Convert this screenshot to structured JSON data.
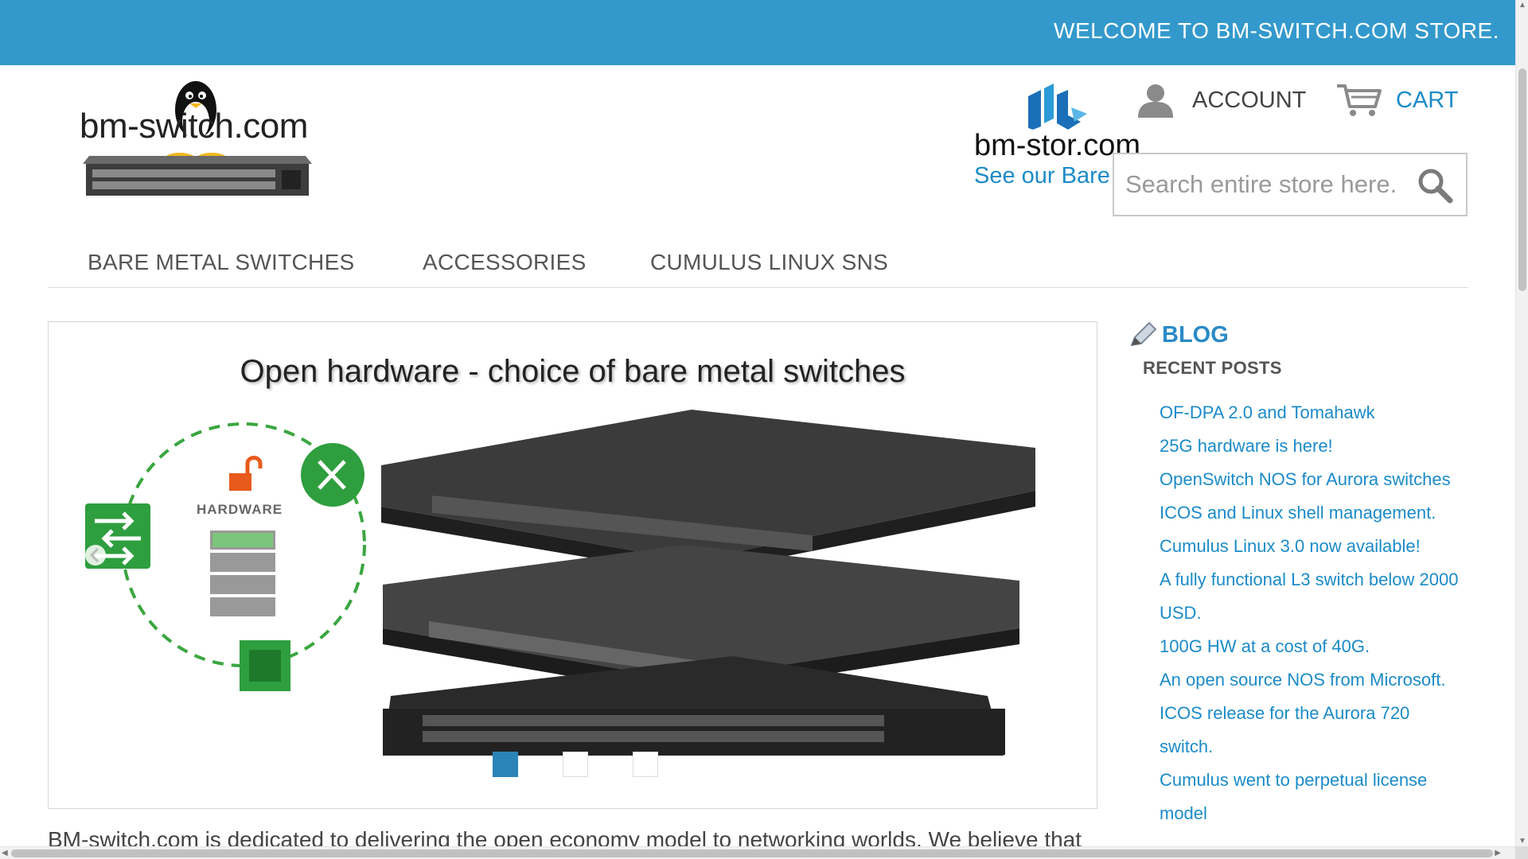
{
  "topbar": {
    "welcome": "WELCOME TO BM-SWITCH.COM STORE."
  },
  "header": {
    "logo_text": "bm-switch.com",
    "partner_text": "bm-stor.com",
    "partner_link": "See our Bare",
    "account_label": "ACCOUNT",
    "cart_label": "CART"
  },
  "search": {
    "placeholder": "Search entire store here."
  },
  "nav": {
    "items": [
      "BARE METAL SWITCHES",
      "ACCESSORIES",
      "CUMULUS LINUX SNS"
    ]
  },
  "slider": {
    "title": "Open hardware - choice of bare metal switches",
    "hardware_label": "HARDWARE",
    "dot_count": 3,
    "active_dot": 1
  },
  "blog": {
    "title": "BLOG",
    "recent_heading": "RECENT POSTS",
    "posts": [
      "OF-DPA 2.0 and Tomahawk",
      "25G hardware is here!",
      "OpenSwitch NOS for Aurora switches",
      "ICOS and Linux shell management.",
      "Cumulus Linux 3.0 now available!",
      "A fully functional L3 switch below 2000 USD.",
      "100G HW at a cost of 40G.",
      "An open source NOS from Microsoft.",
      "ICOS release for the Aurora 720 switch.",
      "Cumulus went to perpetual license model"
    ]
  },
  "intro": {
    "text": "BM-switch.com is dedicated to delivering the open economy model to networking worlds. We believe that"
  },
  "colors": {
    "brand_blue": "#3399cc",
    "link_blue": "#1b8bc8",
    "green": "#2e9e3e"
  }
}
